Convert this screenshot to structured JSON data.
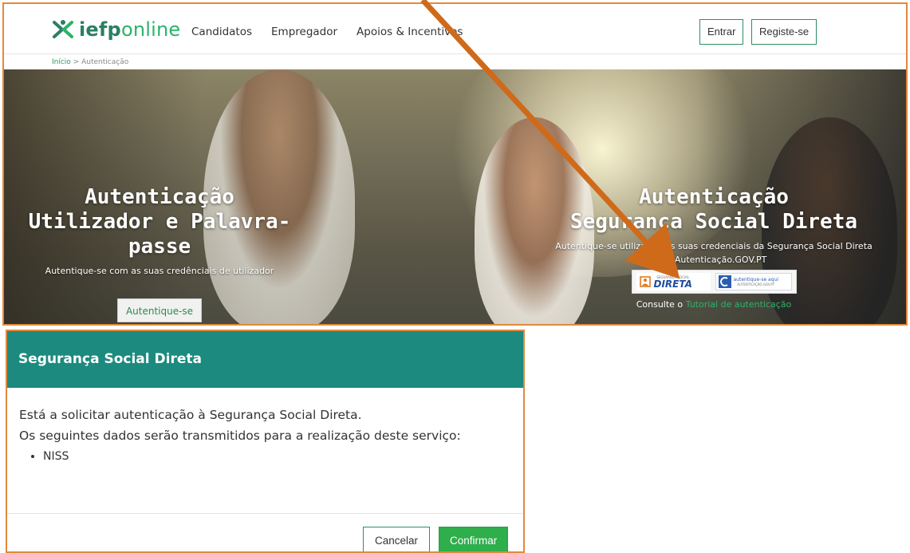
{
  "navbar": {
    "logo_main": "iefp",
    "logo_rest": "online",
    "links": [
      "Candidatos",
      "Empregador",
      "Apoios & Incentivos"
    ],
    "login": "Entrar",
    "register": "Registe-se"
  },
  "breadcrumb": {
    "home": "Início",
    "sep": ">",
    "current": "Autenticação"
  },
  "hero": {
    "left": {
      "title_line1": "Autenticação",
      "title_line2": "Utilizador e Palavra-passe",
      "subtitle": "Autentique-se com as suas credênciais de utilizador",
      "button": "Autentique-se"
    },
    "right": {
      "title_line1": "Autenticação",
      "title_line2": "Segurança Social Direta",
      "subtitle_line1": "Autentique-se utilizando as suas credenciais da Segurança Social Direta",
      "subtitle_line2": "ou Autenticação.GOV.PT",
      "ssd_small": "SEGURANÇA SOCIAL",
      "ssd_big": "DIRETA",
      "gov_line1": "autentique-se aqui",
      "gov_line2": "AUTENTICAÇÃO.GOV.PT",
      "consult_prefix": "Consulte o",
      "consult_link": "Tutorial de autenticação"
    }
  },
  "modal": {
    "title": "Segurança Social Direta",
    "line1": "Está a solicitar autenticação à Segurança Social Direta.",
    "line2": "Os seguintes dados serão transmitidos para a realização deste serviço:",
    "items": [
      "NISS"
    ],
    "cancel": "Cancelar",
    "confirm": "Confirmar"
  },
  "colors": {
    "frame_border": "#e08a3c",
    "annotation_arrow": "#cf6a1a",
    "brand_green": "#2a7f62",
    "modal_header": "#1c8a7f",
    "confirm_button": "#2fae4c"
  }
}
